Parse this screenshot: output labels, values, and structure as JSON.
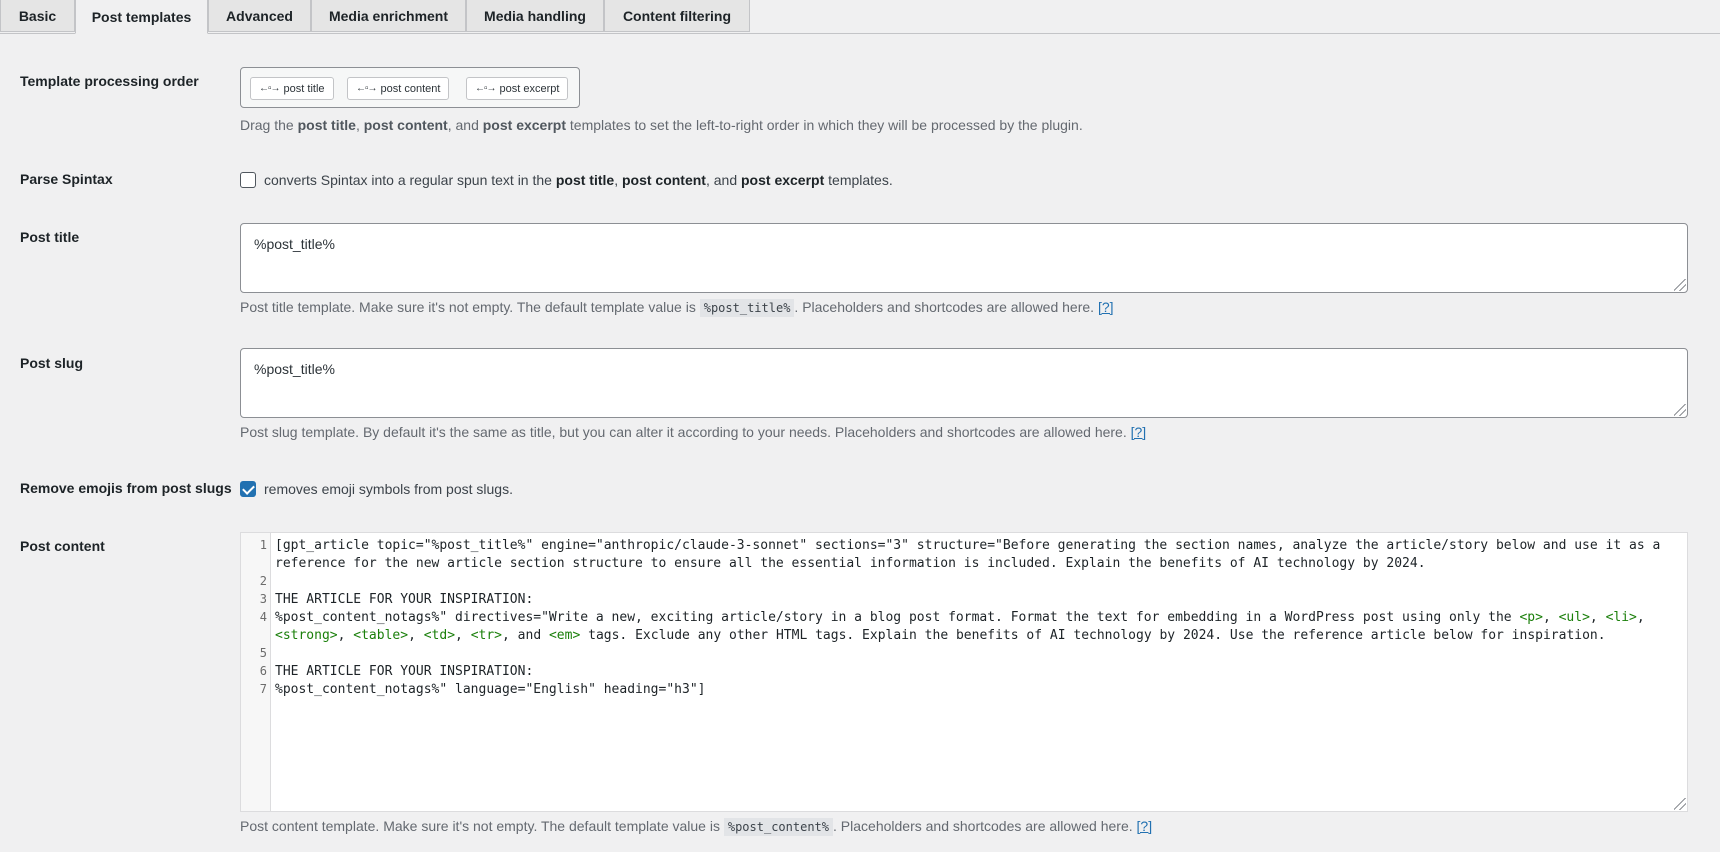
{
  "tabs": [
    {
      "label": "Basic",
      "active": false
    },
    {
      "label": "Post templates",
      "active": true
    },
    {
      "label": "Advanced",
      "active": false
    },
    {
      "label": "Media enrichment",
      "active": false
    },
    {
      "label": "Media handling",
      "active": false
    },
    {
      "label": "Content filtering",
      "active": false
    }
  ],
  "order": {
    "label": "Template processing order",
    "items": [
      "post title",
      "post content",
      "post excerpt"
    ],
    "desc_pre": "Drag the ",
    "desc_t1": "post title",
    "desc_s1": ", ",
    "desc_t2": "post content",
    "desc_s2": ", and ",
    "desc_t3": "post excerpt",
    "desc_post": " templates to set the left-to-right order in which they will be processed by the plugin."
  },
  "spintax": {
    "label": "Parse Spintax",
    "checked": false,
    "text_pre": "converts Spintax into a regular spun text in the ",
    "t1": "post title",
    "s1": ", ",
    "t2": "post content",
    "s2": ", and ",
    "t3": "post excerpt",
    "text_post": " templates."
  },
  "post_title": {
    "label": "Post title",
    "value": "%post_title%",
    "desc_pre": "Post title template. Make sure it's not empty. The default template value is ",
    "desc_code": "%post_title%",
    "desc_post": ". Placeholders and shortcodes are allowed here. ",
    "help": "[?]"
  },
  "post_slug": {
    "label": "Post slug",
    "value": "%post_title%",
    "desc": "Post slug template. By default it's the same as title, but you can alter it according to your needs. Placeholders and shortcodes are allowed here. ",
    "help": "[?]"
  },
  "emojis": {
    "label": "Remove emojis from post slugs",
    "checked": true,
    "text": "removes emoji symbols from post slugs."
  },
  "post_content": {
    "label": "Post content",
    "line_numbers": [
      "1",
      "2",
      "3",
      "4",
      "5",
      "6",
      "7"
    ],
    "lines": {
      "l1a": "[gpt_article topic=\"%post_title%\" engine=\"anthropic/claude-3-sonnet\" sections=\"3\" structure=\"Before generating the section names, analyze the article/story below and use it as a",
      "l1b": "reference for the new article section structure to ensure all the essential information is included. Explain the benefits of AI technology by 2024.",
      "l3": "THE ARTICLE FOR YOUR INSPIRATION:",
      "l4a_pre": "%post_content_notags%\" directives=\"Write a new, exciting article/story in a blog post format. Format the text for embedding in a WordPress post using only the ",
      "tag_p": "<p>",
      "tag_ul": "<ul>",
      "tag_li": "<li>",
      "tag_strong": "<strong>",
      "tag_table": "<table>",
      "tag_td": "<td>",
      "tag_tr": "<tr>",
      "tag_em": "<em>",
      "sep": ", ",
      "sep_and": ", and ",
      "l4b_post": " tags. Exclude any other HTML tags. Explain the benefits of AI technology by 2024. Use the reference article below for inspiration.",
      "l6": "THE ARTICLE FOR YOUR INSPIRATION:",
      "l7": "%post_content_notags%\" language=\"English\" heading=\"h3\"]"
    },
    "desc_pre": "Post content template. Make sure it's not empty. The default template value is ",
    "desc_code": "%post_content%",
    "desc_post": ". Placeholders and shortcodes are allowed here. ",
    "help": "[?]"
  }
}
